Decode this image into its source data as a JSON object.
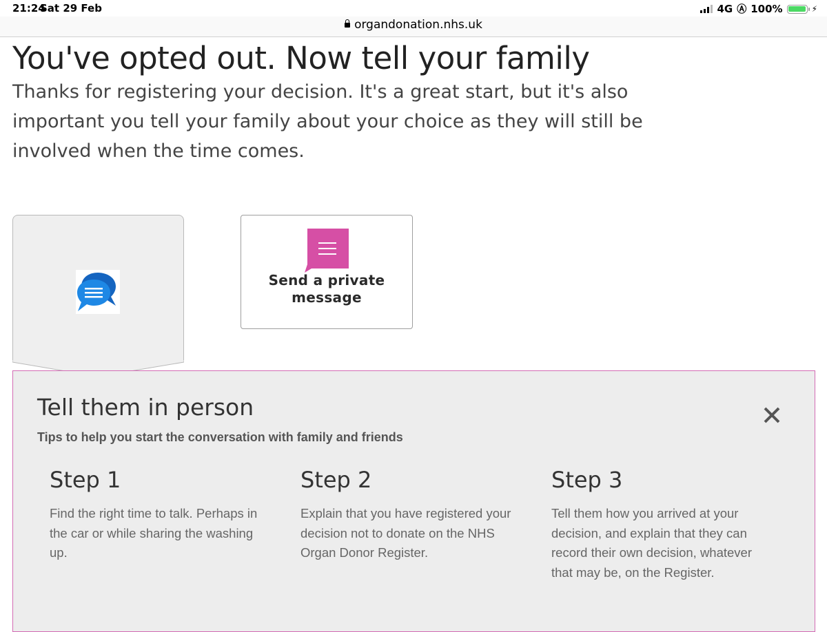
{
  "status_bar": {
    "time": "21:24",
    "date": "Sat 29 Feb",
    "network": "4G",
    "battery": "100%"
  },
  "browser": {
    "url": "organdonation.nhs.uk"
  },
  "page": {
    "title": "You've opted out. Now tell your family",
    "intro": "Thanks for registering your decision. It's a great start, but it's also important you tell your family about your choice as they will still be involved when the time comes."
  },
  "options": {
    "in_person": {
      "icon": "chat-bubbles-icon",
      "selected": true
    },
    "private_message": {
      "icon": "message-icon",
      "label_line1": "Send a private",
      "label_line2": "message"
    }
  },
  "panel": {
    "title": "Tell them in person",
    "subtitle": "Tips to help you start the conversation with family and friends",
    "close_icon": "close-icon",
    "steps": [
      {
        "title": "Step 1",
        "text": "Find the right time to talk. Perhaps in the car or while sharing the washing up."
      },
      {
        "title": "Step 2",
        "text": "Explain that you have registered your decision not to donate on the NHS Organ Donor Register."
      },
      {
        "title": "Step 3",
        "text": "Tell them how you arrived at your decision, and explain that they can record their own decision, whatever that may be, on the Register."
      }
    ]
  },
  "colors": {
    "accent_pink": "#d64fa5",
    "chat_blue": "#1e88e5",
    "panel_bg": "#ededed",
    "battery_green": "#4cd964"
  }
}
